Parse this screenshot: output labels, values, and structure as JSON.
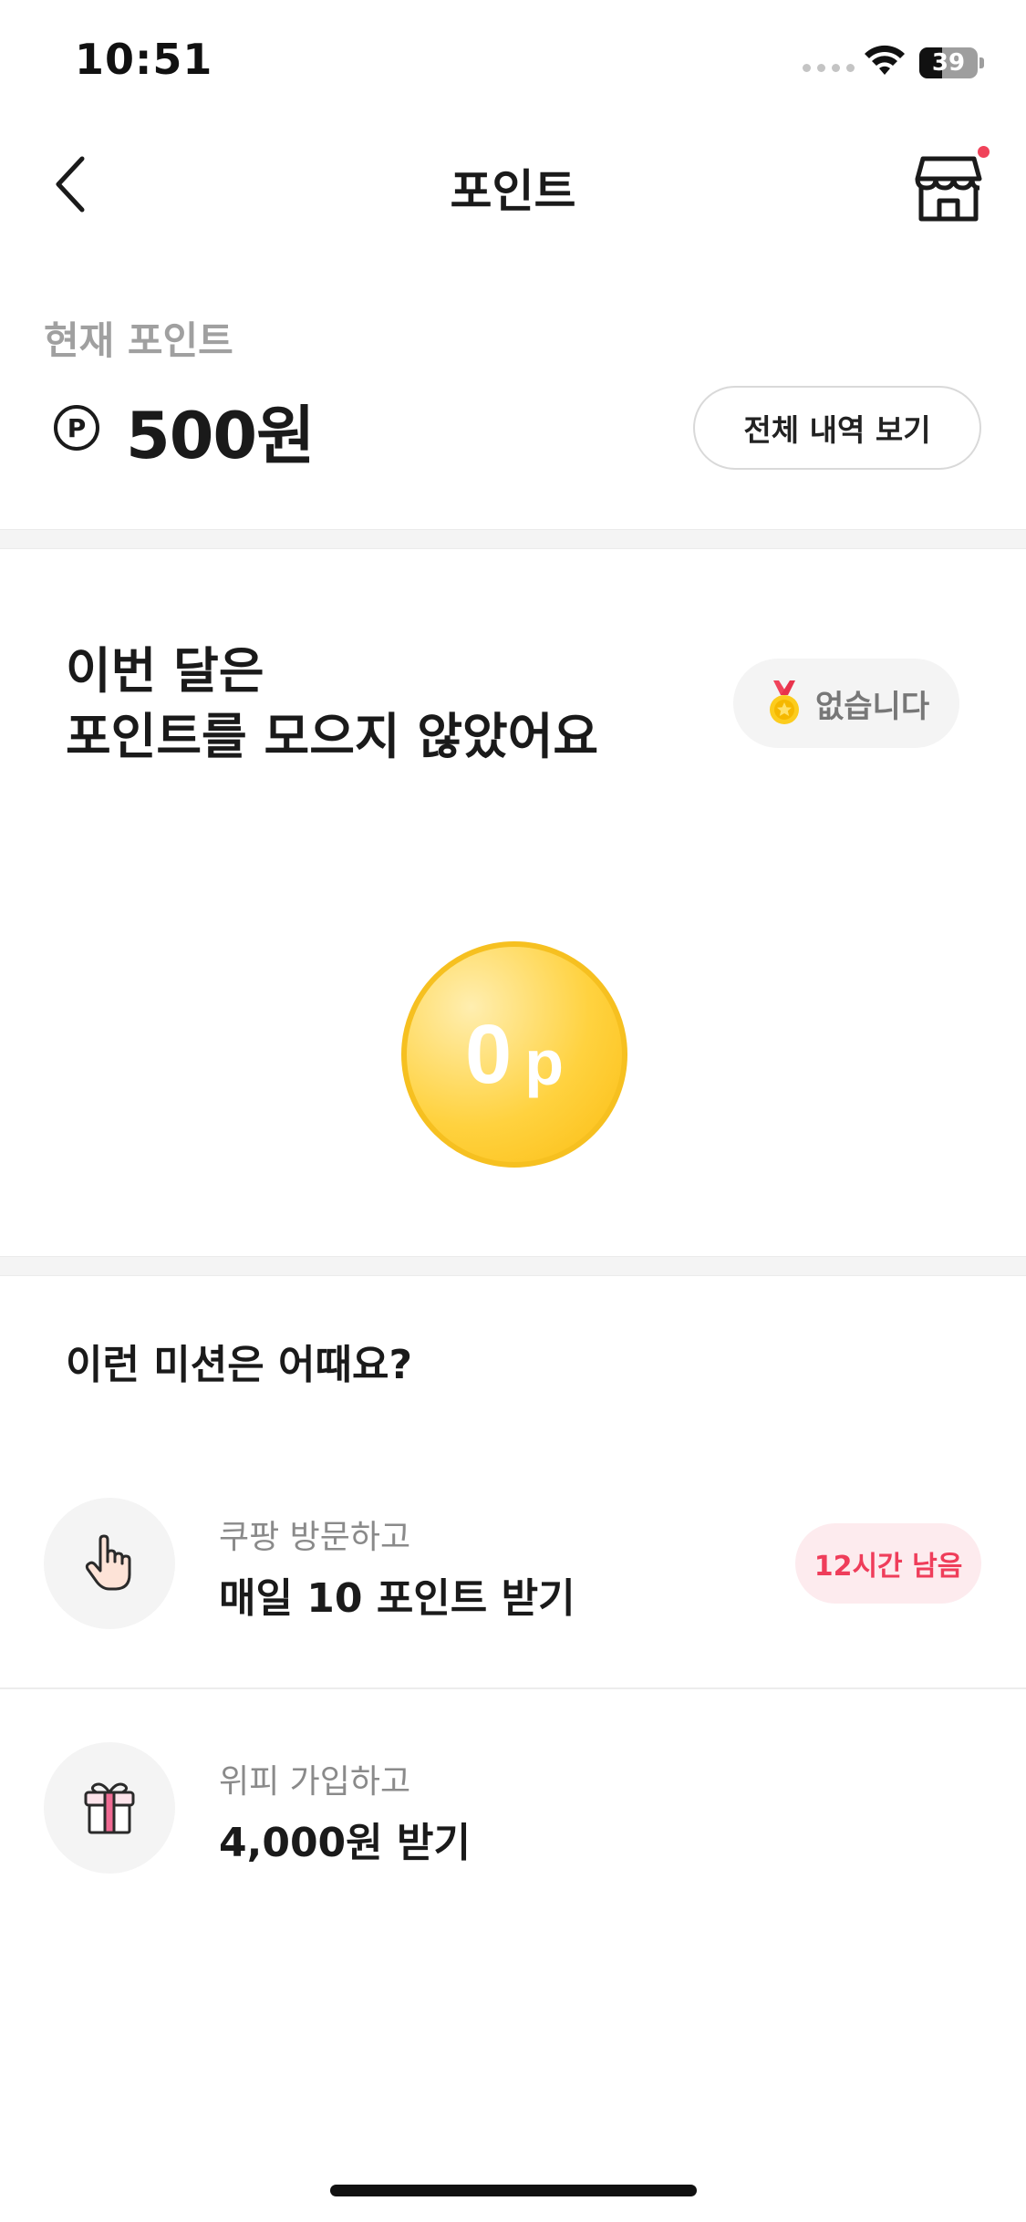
{
  "status_bar": {
    "time": "10:51",
    "battery": "39",
    "battery_level": 0.39
  },
  "header": {
    "title": "포인트",
    "back_icon": "chevron-left-icon",
    "store_icon": "store-icon",
    "has_notification": true
  },
  "current_points": {
    "label": "현재 포인트",
    "symbol": "P",
    "balance": "500원",
    "history_button": "전체 내역 보기"
  },
  "monthly": {
    "title_line1": "이번 달은",
    "title_line2": "포인트를 모으지 않았어요",
    "badge_icon": "medal-icon",
    "badge_text": "없습니다",
    "coin_value": "0",
    "coin_unit": "p"
  },
  "missions": {
    "heading": "이런 미션은 어때요?",
    "items": [
      {
        "icon": "pointing-hand-icon",
        "subtitle": "쿠팡 방문하고",
        "title": "매일 10 포인트 받기",
        "badge": "12시간 남음"
      },
      {
        "icon": "gift-icon",
        "subtitle": "위피 가입하고",
        "title": "4,000원 받기"
      }
    ]
  },
  "colors": {
    "accent_red": "#ef3d5a",
    "coin_gold": "#fbbd12",
    "muted_text": "#8a8a8a"
  }
}
